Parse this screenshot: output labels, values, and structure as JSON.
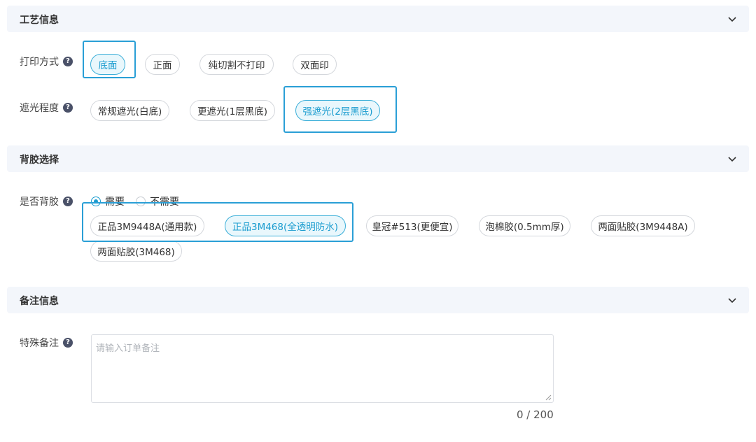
{
  "sections": {
    "craft": {
      "title": "工艺信息"
    },
    "backing": {
      "title": "背胶选择"
    },
    "notes": {
      "title": "备注信息"
    }
  },
  "print_method": {
    "label": "打印方式",
    "options": [
      "底面",
      "正面",
      "纯切割不打印",
      "双面印"
    ],
    "selected": "底面"
  },
  "shading": {
    "label": "遮光程度",
    "options": [
      "常规遮光(白底)",
      "更遮光(1层黑底)",
      "强遮光(2层黑底)"
    ],
    "selected": "强遮光(2层黑底)"
  },
  "backing_glue": {
    "label": "是否背胶",
    "radio": [
      "需要",
      "不需要"
    ],
    "radio_selected": "需要",
    "options": [
      "正品3M9448A(通用款)",
      "正品3M468(全透明防水)",
      "皇冠#513(更便宜)",
      "泡棉胶(0.5mm厚)",
      "两面贴胶(3M9448A)",
      "两面贴胶(3M468)"
    ],
    "selected": "正品3M468(全透明防水)"
  },
  "special_note": {
    "label": "特殊备注",
    "placeholder": "请输入订单备注",
    "value": "",
    "counter": "0 / 200"
  },
  "icons": {
    "help": "question-circle-icon",
    "collapse": "chevron-down-icon"
  },
  "colors": {
    "accent": "#1a9ccf",
    "highlight": "#2a9fd6",
    "section_bg": "#f3f6fb"
  }
}
